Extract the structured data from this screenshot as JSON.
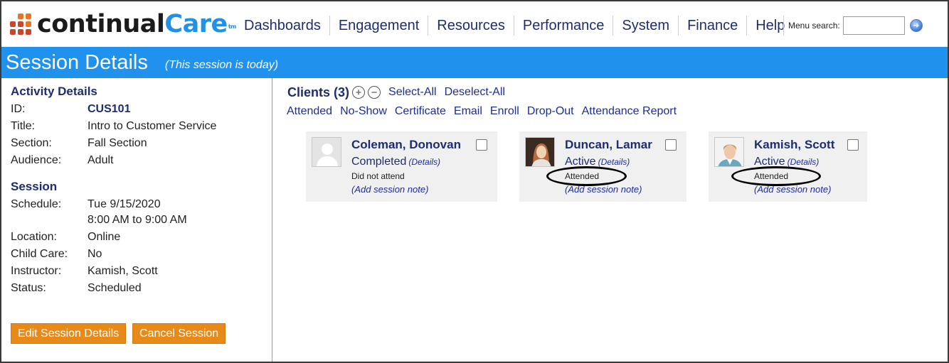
{
  "header": {
    "logo": {
      "part1": "continual",
      "part2": "Care",
      "tm": "tm"
    },
    "nav": [
      "Dashboards",
      "Engagement",
      "Resources",
      "Performance",
      "System",
      "Finance",
      "Help"
    ],
    "menu_search_label": "Menu search:",
    "menu_search_value": "",
    "menu_search_placeholder": ""
  },
  "titlebar": {
    "title": "Session Details",
    "subtitle": "(This session is today)"
  },
  "activity": {
    "heading": "Activity Details",
    "fields": [
      {
        "label": "ID:",
        "value": "CUS101"
      },
      {
        "label": "Title:",
        "value": "Intro to Customer Service"
      },
      {
        "label": "Section:",
        "value": "Fall Section"
      },
      {
        "label": "Audience:",
        "value": "Adult"
      }
    ]
  },
  "session": {
    "heading": "Session",
    "schedule_label": "Schedule:",
    "schedule_date": "Tue 9/15/2020",
    "schedule_time": "8:00 AM to 9:00 AM",
    "fields": [
      {
        "label": "Location:",
        "value": "Online"
      },
      {
        "label": "Child Care:",
        "value": "No"
      },
      {
        "label": "Instructor:",
        "value": "Kamish, Scott"
      },
      {
        "label": "Status:",
        "value": "Scheduled"
      }
    ]
  },
  "buttons": {
    "edit": "Edit Session Details",
    "cancel": "Cancel Session"
  },
  "clients": {
    "title": "Clients (3)",
    "expand_icon": "+",
    "collapse_icon": "−",
    "select_all": "Select-All",
    "deselect_all": "Deselect-All",
    "actions": [
      "Attended",
      "No-Show",
      "Certificate",
      "Email",
      "Enroll",
      "Drop-Out",
      "Attendance Report"
    ],
    "cards": [
      {
        "name": "Coleman, Donovan",
        "status": "Completed",
        "details": "(Details)",
        "attendance": "Did not attend",
        "note": "(Add session note)",
        "avatar": "placeholder-avatar"
      },
      {
        "name": "Duncan, Lamar",
        "status": "Active",
        "details": "(Details)",
        "attendance": "Attended",
        "note": "(Add session note)",
        "avatar": "photo-avatar"
      },
      {
        "name": "Kamish, Scott",
        "status": "Active",
        "details": "(Details)",
        "attendance": "Attended",
        "note": "(Add session note)",
        "avatar": "illustrated-avatar"
      }
    ]
  },
  "colors": {
    "brand_blue": "#2191ee",
    "brand_orange": "#e8742a",
    "link_navy": "#1d2d70",
    "button_orange": "#e88a17"
  }
}
